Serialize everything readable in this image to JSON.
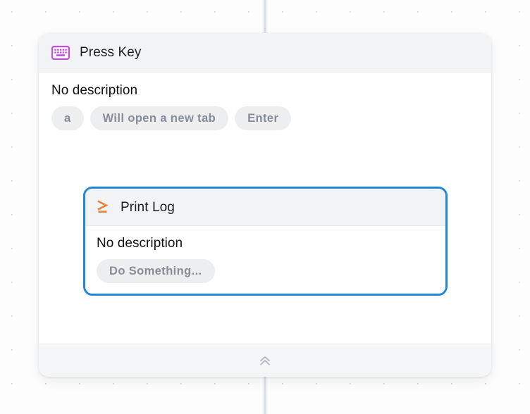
{
  "canvas": {
    "background_color": "#fdfdfd",
    "dot_color": "#dcdee3",
    "connector_color": "#dcdfe5"
  },
  "theme": {
    "selection_border": "#2386dd",
    "header_background": "#f2f3f4",
    "chip_background": "#eceef0",
    "chip_text": "#868d96",
    "keyboard_icon_color": "#c44ce0",
    "terminal_icon_color": "#e8833a",
    "collapse_icon_color": "#b6bcc5"
  },
  "outer_node": {
    "icon": "keyboard-icon",
    "title": "Press Key",
    "description": "No description",
    "chips": [
      {
        "label": "a"
      },
      {
        "label": "Will open a new tab"
      },
      {
        "label": "Enter"
      }
    ],
    "footer": {
      "icon": "double-chevron-up-icon"
    }
  },
  "nested_node": {
    "selected": true,
    "icon": "terminal-prompt-icon",
    "title": "Print Log",
    "description": "No description",
    "chips": [
      {
        "label": "Do Something..."
      }
    ]
  }
}
